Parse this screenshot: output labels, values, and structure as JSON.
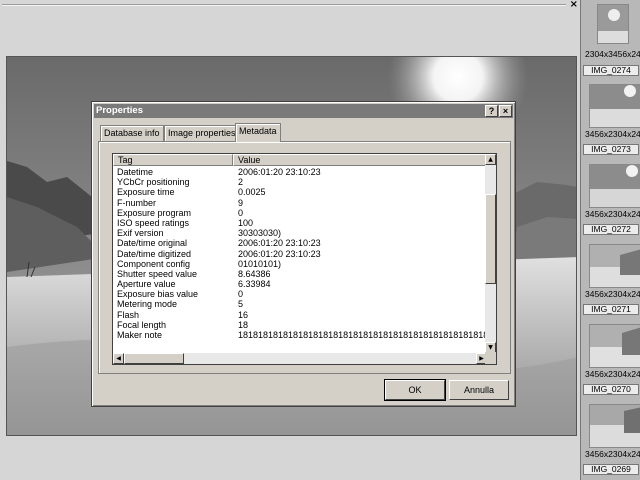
{
  "window": {
    "close_label": "×"
  },
  "dialog": {
    "title": "Properties",
    "help_label": "?",
    "close_label": "×",
    "tabs": [
      "Database info",
      "Image properties",
      "Metadata"
    ],
    "active_tab": "Metadata",
    "columns": [
      "Tag",
      "Value"
    ],
    "rows": [
      {
        "tag": "Datetime",
        "value": "2006:01:20 23:10:23"
      },
      {
        "tag": "YCbCr positioning",
        "value": "2"
      },
      {
        "tag": "Exposure time",
        "value": "0.0025"
      },
      {
        "tag": "F-number",
        "value": "9"
      },
      {
        "tag": "Exposure program",
        "value": "0"
      },
      {
        "tag": "ISO speed ratings",
        "value": "100"
      },
      {
        "tag": "Exif version",
        "value": "30303030)"
      },
      {
        "tag": "Date/time original",
        "value": "2006:01:20 23:10:23"
      },
      {
        "tag": "Date/time digitized",
        "value": "2006:01:20 23:10:23"
      },
      {
        "tag": "Component config",
        "value": "01010101)"
      },
      {
        "tag": "Shutter speed value",
        "value": "8.64386"
      },
      {
        "tag": "Aperture value",
        "value": "6.33984"
      },
      {
        "tag": "Exposure bias value",
        "value": "0"
      },
      {
        "tag": "Metering mode",
        "value": "5"
      },
      {
        "tag": "Flash",
        "value": "16"
      },
      {
        "tag": "Focal length",
        "value": "18"
      },
      {
        "tag": "Maker note",
        "value": "1818181818181818181818181818181818181818181818181818"
      }
    ],
    "ok_label": "OK",
    "cancel_label": "Annulla"
  },
  "thumbnails": [
    {
      "dims": "2304x3456x24",
      "name": "IMG_0274"
    },
    {
      "dims": "3456x2304x24",
      "name": "IMG_0273"
    },
    {
      "dims": "3456x2304x24",
      "name": "IMG_0272"
    },
    {
      "dims": "3456x2304x24",
      "name": "IMG_0271"
    },
    {
      "dims": "3456x2304x24",
      "name": "IMG_0270"
    },
    {
      "dims": "3456x2304x24",
      "name": "IMG_0269"
    }
  ]
}
